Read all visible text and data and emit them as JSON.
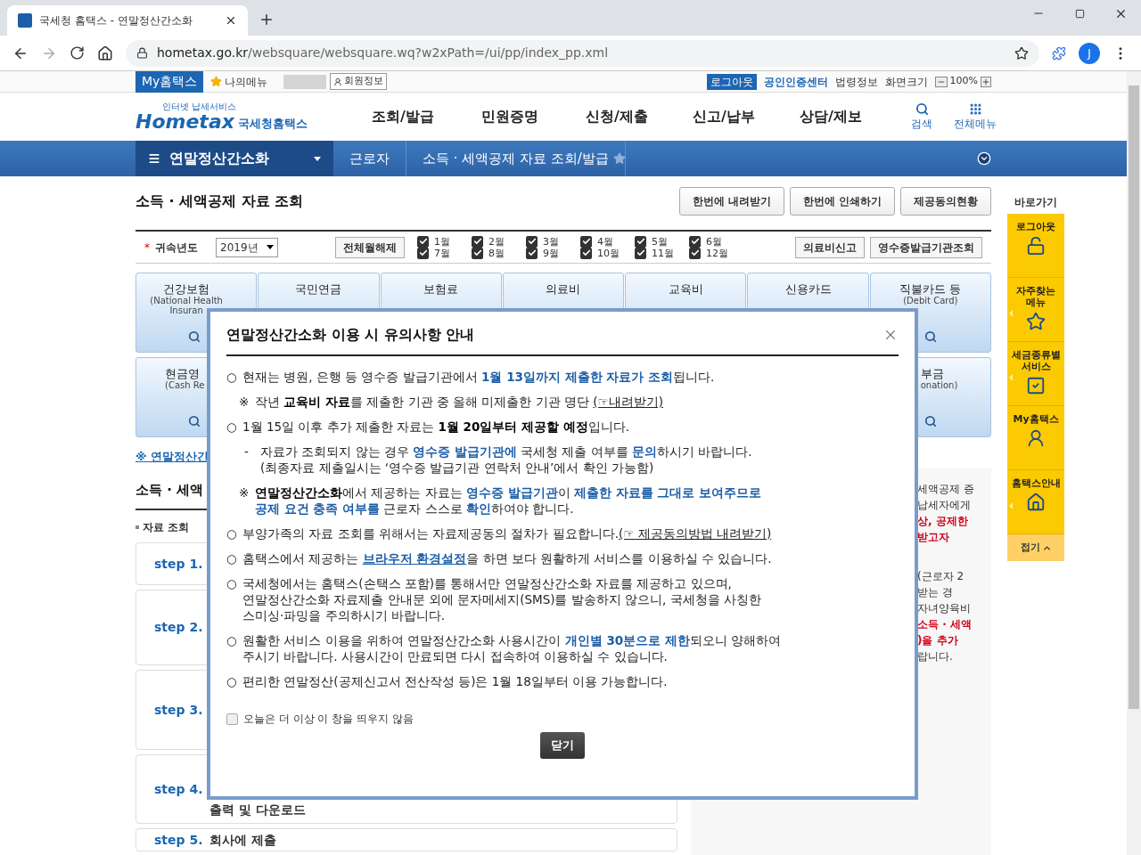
{
  "browser": {
    "tab_title": "국세청 홈택스 - 연말정산간소화",
    "url_host": "hometax.go.kr",
    "url_path": "/websquare/websquare.wq?w2xPath=/ui/pp/index_pp.xml",
    "profile": "J"
  },
  "util_bar": {
    "my": "My홈택스",
    "my_menu": "나의메뉴",
    "member": "회원정보",
    "logout": "로그아웃",
    "cert": "공인인증센터",
    "law": "법령정보",
    "zoom_label": "화면크기",
    "zoom": "100%"
  },
  "header": {
    "logo": "Hometax",
    "logo_tag": "인터넷 납세서비스",
    "logo_sub": "국세청홈택스",
    "nav": [
      "조회/발급",
      "민원증명",
      "신청/제출",
      "신고/납부",
      "상담/제보"
    ],
    "search": "검색",
    "all_menu": "전체메뉴"
  },
  "location_bar": {
    "menu": "연말정산간소화",
    "crumbs": [
      "근로자",
      "소득 · 세액공제 자료 조회/발급"
    ]
  },
  "page": {
    "title": "소득 · 세액공제 자료 조회",
    "actions": [
      "한번에 내려받기",
      "한번에 인쇄하기",
      "제공동의현황"
    ]
  },
  "filter": {
    "required": "*",
    "year_label": "귀속년도",
    "year": "2019년",
    "clear_button": "전체월해제",
    "months": [
      {
        "label": "1월",
        "checked": true
      },
      {
        "label": "2월",
        "checked": true
      },
      {
        "label": "3월",
        "checked": true
      },
      {
        "label": "4월",
        "checked": true
      },
      {
        "label": "5월",
        "checked": true
      },
      {
        "label": "6월",
        "checked": true
      },
      {
        "label": "7월",
        "checked": true
      },
      {
        "label": "8월",
        "checked": true
      },
      {
        "label": "9월",
        "checked": true
      },
      {
        "label": "10월",
        "checked": true
      },
      {
        "label": "11월",
        "checked": true
      },
      {
        "label": "12월",
        "checked": true
      }
    ],
    "buttons": [
      "의료비신고",
      "영수증발급기관조회"
    ]
  },
  "category_cards": [
    {
      "title": "건강보험",
      "subtitle": [
        "(National Health",
        "Insuran"
      ]
    },
    {
      "title": "국민연금"
    },
    {
      "title": "보험료"
    },
    {
      "title": "의료비"
    },
    {
      "title": "교육비"
    },
    {
      "title": "신용카드"
    },
    {
      "title": "직불카드 등",
      "subtitle": [
        "(Debit Card)"
      ]
    }
  ],
  "category_cards_row2": [
    {
      "title": "현금영",
      "subtitle": [
        "(Cash Re"
      ]
    },
    {
      "title": "부금",
      "subtitle": [
        "onation)"
      ]
    }
  ],
  "left": {
    "link": "※ 연말정산간",
    "section_title": "소득 · 세액",
    "sub_title": "자료 조회",
    "steps": [
      {
        "label": "step 1."
      },
      {
        "label": "step 2."
      },
      {
        "label": "step 3."
      },
      {
        "label": "step 4.",
        "text": "출력 및 다운로드"
      },
      {
        "label": "step 5.",
        "text": "회사에 제출"
      }
    ]
  },
  "info_panel": [
    [
      {
        "text": "세액공제 증",
        "emphasis": false
      },
      {
        "text": "납세자에게",
        "emphasis": false
      },
      {
        "text": "상, 공제한",
        "emphasis": true
      },
      {
        "text": "받고자",
        "emphasis": true
      }
    ],
    [
      {
        "text": "(근로자 2",
        "emphasis": false
      },
      {
        "text": "받는 경",
        "emphasis": false
      },
      {
        "text": "자녀양육비",
        "emphasis": false
      },
      {
        "text": "소득 · 세액",
        "emphasis": true
      },
      {
        "text": ")을 추가",
        "emphasis": true
      },
      {
        "text": "랍니다.",
        "emphasis": false
      }
    ]
  ],
  "quick_menu": {
    "title": "바로가기",
    "items": [
      {
        "label": "로그아웃",
        "kind": "logout",
        "expandable": false
      },
      {
        "label": "자주찾는 메뉴",
        "kind": "favorites",
        "expandable": true
      },
      {
        "label": "세금종류별 서비스",
        "kind": "service",
        "expandable": true
      },
      {
        "label": "My홈택스",
        "kind": "my",
        "expandable": false
      },
      {
        "label": "홈택스안내",
        "kind": "guide",
        "expandable": true
      }
    ],
    "collapse": "접기"
  },
  "modal": {
    "title": "연말정산간소화 이용 시 유의사항 안내",
    "items": [
      {
        "kind": "bullet",
        "marker": "○",
        "lines": [
          [
            {
              "t": "현재는 병원, 은행 등 영수증 발급기관에서 ",
              "kind": "plain"
            },
            {
              "t": "1월 13일까지 제출한 자료가 조회",
              "kind": "highlight"
            },
            {
              "t": "됩니다.",
              "kind": "plain"
            }
          ]
        ]
      },
      {
        "kind": "note",
        "marker": "※",
        "lines": [
          [
            {
              "t": "작년 ",
              "kind": "plain"
            },
            {
              "t": "교육비 자료",
              "kind": "strong"
            },
            {
              "t": "를 제출한 기관 중 올해 미제출한 기관 명단 ",
              "kind": "plain"
            },
            {
              "t": "(☞내려받기)",
              "kind": "link"
            }
          ]
        ]
      },
      {
        "kind": "bullet",
        "marker": "○",
        "lines": [
          [
            {
              "t": "1월 15일 이후 추가 제출한 자료는 ",
              "kind": "plain"
            },
            {
              "t": "1월 20일부터 제공할 예정",
              "kind": "strong"
            },
            {
              "t": "입니다.",
              "kind": "plain"
            }
          ]
        ]
      },
      {
        "kind": "dash",
        "marker": "-",
        "lines": [
          [
            {
              "t": "자료가 조회되지 않는 경우 ",
              "kind": "plain"
            },
            {
              "t": "영수증 발급기관에",
              "kind": "highlight"
            },
            {
              "t": " 국세청 제출 여부를 ",
              "kind": "plain"
            },
            {
              "t": "문의",
              "kind": "highlight"
            },
            {
              "t": "하시기 바랍니다.",
              "kind": "plain"
            }
          ],
          [
            {
              "t": "(최종자료 제출일시는 ‘영수증 발급기관 연락처 안내’에서 확인 가능함)",
              "kind": "plain"
            }
          ]
        ]
      },
      {
        "kind": "note",
        "marker": "※",
        "lines": [
          [
            {
              "t": "연말정산간소화",
              "kind": "strong"
            },
            {
              "t": "에서 제공하는 자료는 ",
              "kind": "plain"
            },
            {
              "t": "영수증 발급기관",
              "kind": "highlight"
            },
            {
              "t": "이 ",
              "kind": "plain"
            },
            {
              "t": "제출한 자료를 그대로 보여주므로",
              "kind": "highlight"
            }
          ],
          [
            {
              "t": "공제 요건 충족 여부를",
              "kind": "highlight"
            },
            {
              "t": " 근로자 스스로 ",
              "kind": "plain"
            },
            {
              "t": "확인",
              "kind": "highlight"
            },
            {
              "t": "하여야 합니다.",
              "kind": "plain"
            }
          ]
        ]
      },
      {
        "kind": "bullet",
        "marker": "○",
        "lines": [
          [
            {
              "t": "부양가족의 자료 조회를 위해서는 자료제공동의 절차가 필요합니다.",
              "kind": "plain"
            },
            {
              "t": "(☞ 제공동의방법 내려받기)",
              "kind": "link"
            }
          ]
        ]
      },
      {
        "kind": "bullet",
        "marker": "○",
        "lines": [
          [
            {
              "t": "홈택스에서 제공하는 ",
              "kind": "plain"
            },
            {
              "t": "브라우저 환경설정",
              "kind": "highlight_link"
            },
            {
              "t": "을 하면 보다 원활하게 서비스를 이용하실 수 있습니다.",
              "kind": "plain"
            }
          ]
        ]
      },
      {
        "kind": "bullet",
        "marker": "○",
        "lines": [
          [
            {
              "t": "국세청에서는 홈택스(손택스 포함)를 통해서만 연말정산간소화 자료를 제공하고 있으며,",
              "kind": "plain"
            }
          ],
          [
            {
              "t": "연말정산간소화 자료제출 안내문 외에 문자메세지(SMS)를 발송하지 않으니, 국세청을 사칭한",
              "kind": "plain"
            }
          ],
          [
            {
              "t": "스미싱·파밍을 주의하시기 바랍니다.",
              "kind": "plain"
            }
          ]
        ]
      },
      {
        "kind": "bullet",
        "marker": "○",
        "lines": [
          [
            {
              "t": "원활한 서비스 이용을 위하여 연말정산간소화 사용시간이 ",
              "kind": "plain"
            },
            {
              "t": "개인별 30분으로 제한",
              "kind": "highlight"
            },
            {
              "t": "되오니 양해하여",
              "kind": "plain"
            }
          ],
          [
            {
              "t": "주시기 바랍니다. 사용시간이 만료되면 다시 접속하여 이용하실 수 있습니다.",
              "kind": "plain"
            }
          ]
        ]
      },
      {
        "kind": "bullet",
        "marker": "○",
        "lines": [
          [
            {
              "t": "편리한 연말정산(공제신고서 전산작성 등)은 1월 18일부터 이용 가능합니다.",
              "kind": "plain"
            }
          ]
        ]
      }
    ],
    "dont_show": {
      "label": "오늘은 더 이상 이 창을 띄우지 않음",
      "checked": false
    },
    "close_button": "닫기"
  }
}
